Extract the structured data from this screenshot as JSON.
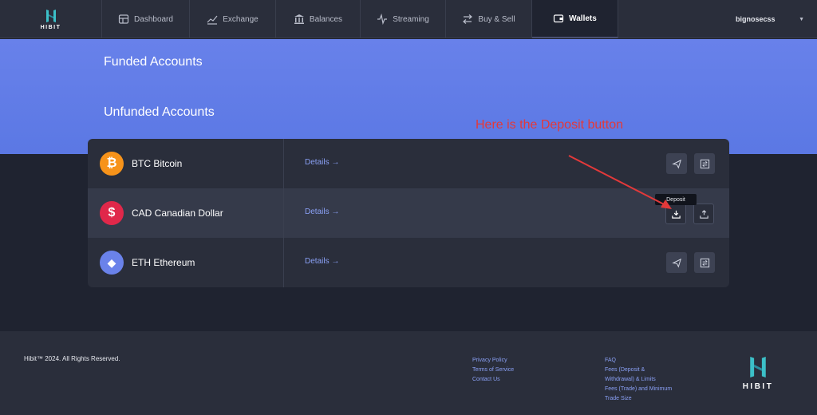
{
  "brand": {
    "name": "HIBIT",
    "accent": "#3cc0c8"
  },
  "nav": {
    "items": [
      {
        "label": "Dashboard",
        "icon": "dashboard-icon"
      },
      {
        "label": "Exchange",
        "icon": "chart-line-icon"
      },
      {
        "label": "Balances",
        "icon": "bank-icon"
      },
      {
        "label": "Streaming",
        "icon": "pulse-icon"
      },
      {
        "label": "Buy & Sell",
        "icon": "swap-arrows-icon"
      },
      {
        "label": "Wallets",
        "icon": "wallet-icon",
        "active": true
      }
    ],
    "user": "bignosecss"
  },
  "hero": {
    "funded_title": "Funded Accounts",
    "unfunded_title": "Unfunded Accounts"
  },
  "accounts": [
    {
      "symbol": "BTC",
      "name": "Bitcoin",
      "label": "BTC Bitcoin",
      "color": "#f7931a",
      "glyph": "₿",
      "details": "Details →"
    },
    {
      "symbol": "CAD",
      "name": "Canadian Dollar",
      "label": "CAD Canadian Dollar",
      "color": "#e0284a",
      "glyph": "$",
      "details": "Details →"
    },
    {
      "symbol": "ETH",
      "name": "Ethereum",
      "label": "ETH Ethereum",
      "color": "#6a82ea",
      "glyph": "◆",
      "details": "Details →"
    }
  ],
  "tooltip": "Deposit",
  "annotation": {
    "text": "Here is the Deposit button",
    "color": "#e3393a"
  },
  "footer": {
    "copyright": "Hibit™ 2024. All Rights Reserved.",
    "col1": [
      "Privacy Policy",
      "Terms of Service",
      "Contact Us"
    ],
    "col2": [
      "FAQ",
      "Fees (Deposit &",
      "Withdrawal) & Limits",
      "Fees (Trade) and Minimum",
      "Trade Size"
    ],
    "logo_text": "HIBIT"
  }
}
